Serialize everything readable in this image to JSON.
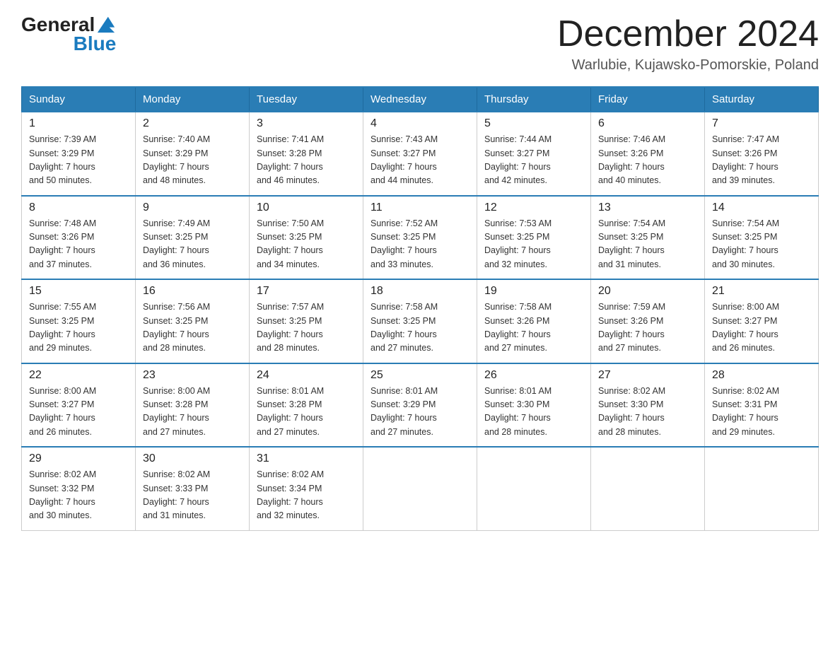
{
  "header": {
    "logo_general": "General",
    "logo_blue": "Blue",
    "month": "December 2024",
    "location": "Warlubie, Kujawsko-Pomorskie, Poland"
  },
  "days_of_week": [
    "Sunday",
    "Monday",
    "Tuesday",
    "Wednesday",
    "Thursday",
    "Friday",
    "Saturday"
  ],
  "weeks": [
    [
      {
        "day": "1",
        "sunrise": "7:39 AM",
        "sunset": "3:29 PM",
        "daylight": "7 hours and 50 minutes."
      },
      {
        "day": "2",
        "sunrise": "7:40 AM",
        "sunset": "3:29 PM",
        "daylight": "7 hours and 48 minutes."
      },
      {
        "day": "3",
        "sunrise": "7:41 AM",
        "sunset": "3:28 PM",
        "daylight": "7 hours and 46 minutes."
      },
      {
        "day": "4",
        "sunrise": "7:43 AM",
        "sunset": "3:27 PM",
        "daylight": "7 hours and 44 minutes."
      },
      {
        "day": "5",
        "sunrise": "7:44 AM",
        "sunset": "3:27 PM",
        "daylight": "7 hours and 42 minutes."
      },
      {
        "day": "6",
        "sunrise": "7:46 AM",
        "sunset": "3:26 PM",
        "daylight": "7 hours and 40 minutes."
      },
      {
        "day": "7",
        "sunrise": "7:47 AM",
        "sunset": "3:26 PM",
        "daylight": "7 hours and 39 minutes."
      }
    ],
    [
      {
        "day": "8",
        "sunrise": "7:48 AM",
        "sunset": "3:26 PM",
        "daylight": "7 hours and 37 minutes."
      },
      {
        "day": "9",
        "sunrise": "7:49 AM",
        "sunset": "3:25 PM",
        "daylight": "7 hours and 36 minutes."
      },
      {
        "day": "10",
        "sunrise": "7:50 AM",
        "sunset": "3:25 PM",
        "daylight": "7 hours and 34 minutes."
      },
      {
        "day": "11",
        "sunrise": "7:52 AM",
        "sunset": "3:25 PM",
        "daylight": "7 hours and 33 minutes."
      },
      {
        "day": "12",
        "sunrise": "7:53 AM",
        "sunset": "3:25 PM",
        "daylight": "7 hours and 32 minutes."
      },
      {
        "day": "13",
        "sunrise": "7:54 AM",
        "sunset": "3:25 PM",
        "daylight": "7 hours and 31 minutes."
      },
      {
        "day": "14",
        "sunrise": "7:54 AM",
        "sunset": "3:25 PM",
        "daylight": "7 hours and 30 minutes."
      }
    ],
    [
      {
        "day": "15",
        "sunrise": "7:55 AM",
        "sunset": "3:25 PM",
        "daylight": "7 hours and 29 minutes."
      },
      {
        "day": "16",
        "sunrise": "7:56 AM",
        "sunset": "3:25 PM",
        "daylight": "7 hours and 28 minutes."
      },
      {
        "day": "17",
        "sunrise": "7:57 AM",
        "sunset": "3:25 PM",
        "daylight": "7 hours and 28 minutes."
      },
      {
        "day": "18",
        "sunrise": "7:58 AM",
        "sunset": "3:25 PM",
        "daylight": "7 hours and 27 minutes."
      },
      {
        "day": "19",
        "sunrise": "7:58 AM",
        "sunset": "3:26 PM",
        "daylight": "7 hours and 27 minutes."
      },
      {
        "day": "20",
        "sunrise": "7:59 AM",
        "sunset": "3:26 PM",
        "daylight": "7 hours and 27 minutes."
      },
      {
        "day": "21",
        "sunrise": "8:00 AM",
        "sunset": "3:27 PM",
        "daylight": "7 hours and 26 minutes."
      }
    ],
    [
      {
        "day": "22",
        "sunrise": "8:00 AM",
        "sunset": "3:27 PM",
        "daylight": "7 hours and 26 minutes."
      },
      {
        "day": "23",
        "sunrise": "8:00 AM",
        "sunset": "3:28 PM",
        "daylight": "7 hours and 27 minutes."
      },
      {
        "day": "24",
        "sunrise": "8:01 AM",
        "sunset": "3:28 PM",
        "daylight": "7 hours and 27 minutes."
      },
      {
        "day": "25",
        "sunrise": "8:01 AM",
        "sunset": "3:29 PM",
        "daylight": "7 hours and 27 minutes."
      },
      {
        "day": "26",
        "sunrise": "8:01 AM",
        "sunset": "3:30 PM",
        "daylight": "7 hours and 28 minutes."
      },
      {
        "day": "27",
        "sunrise": "8:02 AM",
        "sunset": "3:30 PM",
        "daylight": "7 hours and 28 minutes."
      },
      {
        "day": "28",
        "sunrise": "8:02 AM",
        "sunset": "3:31 PM",
        "daylight": "7 hours and 29 minutes."
      }
    ],
    [
      {
        "day": "29",
        "sunrise": "8:02 AM",
        "sunset": "3:32 PM",
        "daylight": "7 hours and 30 minutes."
      },
      {
        "day": "30",
        "sunrise": "8:02 AM",
        "sunset": "3:33 PM",
        "daylight": "7 hours and 31 minutes."
      },
      {
        "day": "31",
        "sunrise": "8:02 AM",
        "sunset": "3:34 PM",
        "daylight": "7 hours and 32 minutes."
      },
      null,
      null,
      null,
      null
    ]
  ]
}
